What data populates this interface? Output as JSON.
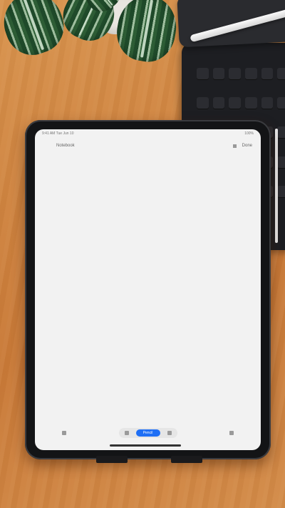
{
  "ipad": {
    "status_left": "9:41 AM  Tue Jun 10",
    "status_right": "100%",
    "toolbar_title": "Notebook",
    "toolbar_right": "Done",
    "bottom_left": "",
    "bottom_button": "Pencil",
    "bottom_right": ""
  },
  "colors": {
    "accent": "#1f6ff5",
    "desk": "#cf8440",
    "screen": "#f2f2f2",
    "device": "#131416"
  },
  "icons": [
    "sidebar-icon",
    "undo-icon",
    "redo-icon",
    "grid-icon",
    "share-icon",
    "pencil-icon"
  ]
}
